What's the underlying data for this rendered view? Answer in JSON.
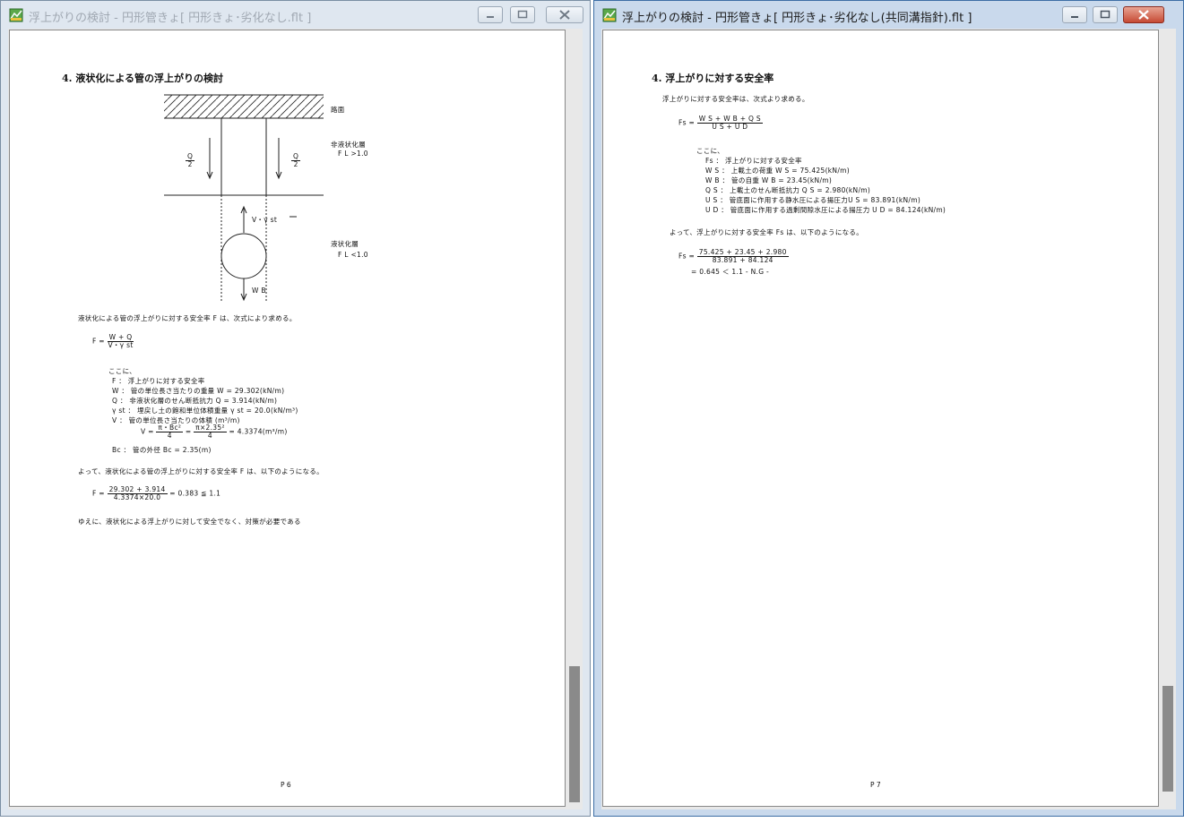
{
  "left": {
    "title": "浮上がりの検討 - 円形管きょ[ 円形きょ･劣化なし.flt ]",
    "heading": "4.  液状化による管の浮上がりの検討",
    "diagram": {
      "surface": "路面",
      "upper_layer": "非液状化層",
      "upper_fl": "F L >1.0",
      "lower_layer": "液状化層",
      "lower_fl": "F L <1.0",
      "q_num": "Q",
      "q_den": "2",
      "v_gamma": "V・γ st",
      "w_label": "W B"
    },
    "intro": "液状化による管の浮上がりに対する安全率 F は、次式により求める。",
    "formula_lhs": "F =",
    "formula_num": "W + Q",
    "formula_den": "V・γ st",
    "koko": "ここに、",
    "defs": [
      "F    ： 浮上がりに対する安全率",
      "W    ： 管の単位長さ当たりの重量 W = 29.302(kN/m)",
      "Q    ： 非液状化層のせん断抵抗力 Q = 3.914(kN/m)",
      "γ st ： 埋戻し土の飽和単位体積重量 γ st = 20.0(kN/m³)",
      "V    ： 管の単位長さ当たりの体積 (m³/m)"
    ],
    "v_lhs": "V =",
    "v_num1": "π・Bc²",
    "v_den1": "4",
    "v_eq": "=",
    "v_num2": "π×2.35²",
    "v_den2": "4",
    "v_result": "= 4.3374(m³/m)",
    "bc": "Bc  ： 管の外径 Bc = 2.35(m)",
    "yotte": "よって、液状化による管の浮上がりに対する安全率 F は、以下のようになる。",
    "f_lhs": "F =",
    "f_num": "29.302 + 3.914",
    "f_den": "4.3374×20.0",
    "f_result": "= 0.383  ≦  1.1",
    "conclusion": "ゆえに、液状化による浮上がりに対して安全でなく、対策が必要である",
    "page": "P 6"
  },
  "right": {
    "title": "浮上がりの検討 - 円形管きょ[ 円形きょ･劣化なし(共同溝指針).flt ]",
    "heading": "4.  浮上がりに対する安全率",
    "intro": "浮上がりに対する安全率は、次式より求める。",
    "formula_lhs": "Fs =",
    "formula_num": "W S + W B + Q S",
    "formula_den": "U S + U D",
    "koko": "ここに、",
    "defs": [
      "Fs ： 浮上がりに対する安全率",
      "W S ： 上載土の荷重 W S = 75.425(kN/m)",
      "W B ： 管の自重 W B = 23.45(kN/m)",
      "Q S ： 上載土のせん断抵抗力 Q S = 2.980(kN/m)",
      "U S ： 管底面に作用する静水圧による揚圧力U S = 83.891(kN/m)",
      "U D ： 管底面に作用する過剰間隙水圧による揚圧力 U D = 84.124(kN/m)"
    ],
    "yotte": "よって、浮上がりに対する安全率 Fs は、以下のようになる。",
    "f_lhs": "Fs =",
    "f_num": "75.425 + 23.45 + 2.980",
    "f_den": "83.891 + 84.124",
    "f_result": "= 0.645  ＜  1.1   - N.G -",
    "page": "P 7"
  },
  "colors": {
    "active_title": "#c9d9ec",
    "inactive_title": "#dfe7f0",
    "close": "#c64a34"
  },
  "icons": [
    "app-icon",
    "minimize-icon",
    "maximize-icon",
    "close-icon"
  ]
}
